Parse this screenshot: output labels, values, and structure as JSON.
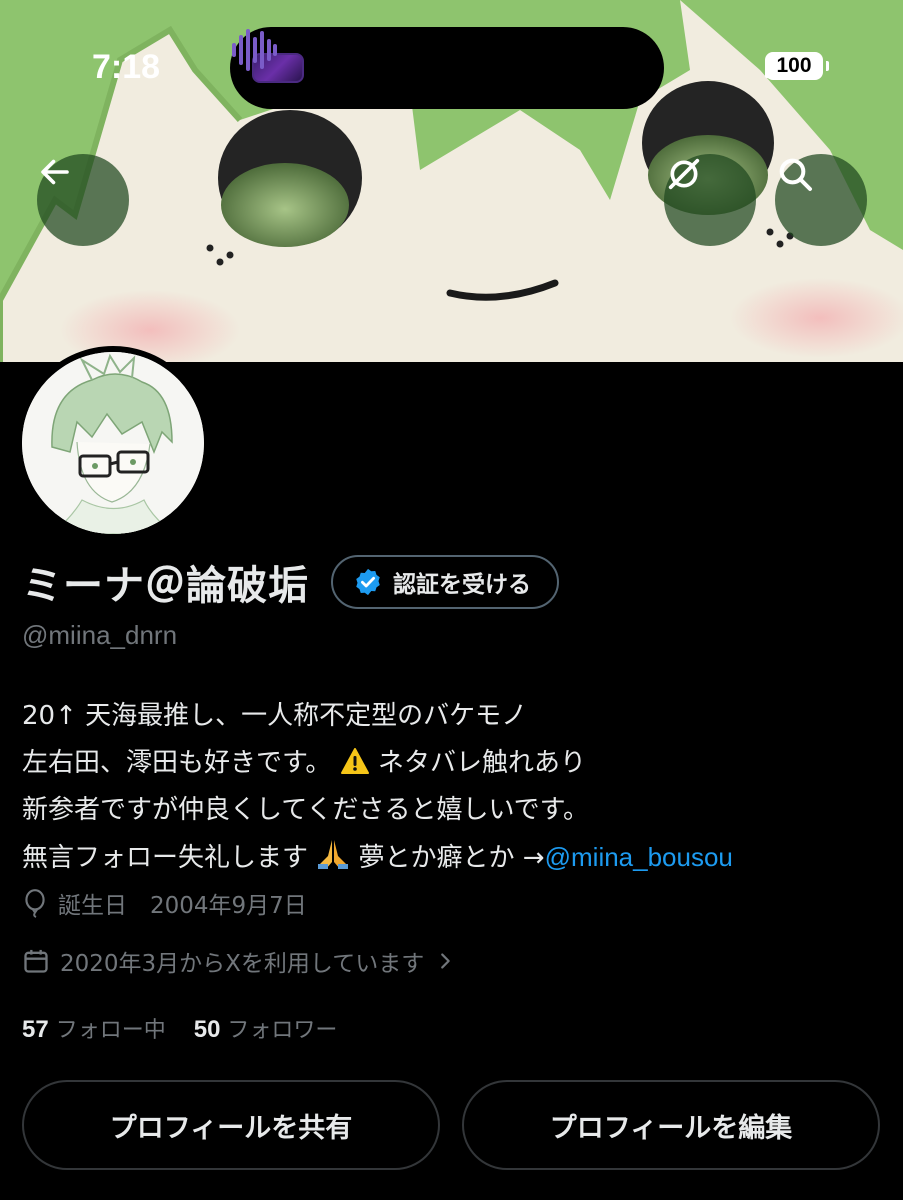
{
  "status_bar": {
    "time": "7:18",
    "battery": "100"
  },
  "profile": {
    "display_name": "ミーナ＠論破垢",
    "verify_button": "認証を受ける",
    "handle": "@miina_dnrn",
    "bio": {
      "line1": "20↑ 天海最推し、一人称不定型のバケモノ",
      "line2_a": "左右田、澪田も好きです。",
      "line2_b": "ネタバレ触れあり",
      "line3": "新参者ですが仲良くしてくださると嬉しいです。",
      "line4_a": "無言フォロー失礼します",
      "line4_b": "夢とか癖とか →",
      "line4_mention": "@miina_bousou"
    },
    "birthday": "誕生日　2004年9月7日",
    "joined": "2020年3月からXを利用しています",
    "following_count": "57",
    "following_label": "フォロー中",
    "followers_count": "50",
    "followers_label": "フォロワー"
  },
  "buttons": {
    "share": "プロフィールを共有",
    "edit": "プロフィールを編集"
  },
  "icons": {
    "back": "arrow-left-icon",
    "grok": "grok-icon",
    "search": "search-icon",
    "verified": "verified-badge-icon",
    "balloon": "balloon-icon",
    "calendar": "calendar-icon",
    "chevron": "chevron-right-icon"
  },
  "colors": {
    "accent": "#1d9bf0",
    "muted": "#71767b",
    "text": "#e7e9ea",
    "background": "#000000"
  }
}
